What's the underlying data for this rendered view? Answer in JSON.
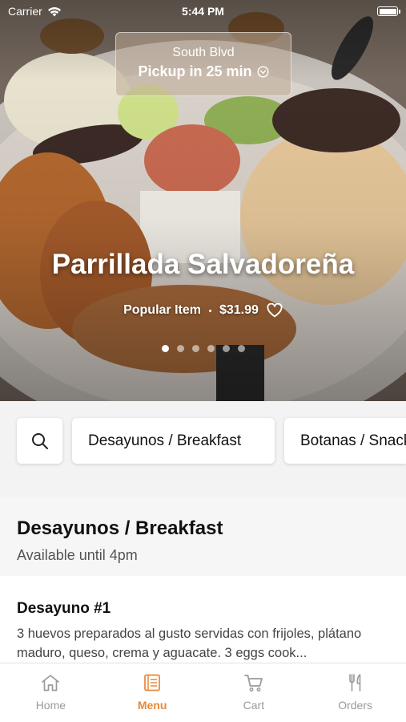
{
  "status_bar": {
    "carrier": "Carrier",
    "time": "5:44 PM"
  },
  "hero": {
    "location": "South Blvd",
    "pickup": "Pickup in 25 min",
    "title": "Parrillada Salvadoreña",
    "badge": "Popular Item",
    "price": "$31.99",
    "carousel": {
      "count": 6,
      "active_index": 0
    }
  },
  "categories": [
    "Desayunos / Breakfast",
    "Botanas / Snacks"
  ],
  "section": {
    "title": "Desayunos / Breakfast",
    "subtitle": "Available until 4pm"
  },
  "item": {
    "name": "Desayuno #1",
    "description": "3 huevos preparados al gusto servidas con frijoles, plátano maduro, queso, crema y aguacate. 3 eggs cook..."
  },
  "tabs": [
    {
      "label": "Home",
      "icon": "home-icon"
    },
    {
      "label": "Menu",
      "icon": "menu-book-icon"
    },
    {
      "label": "Cart",
      "icon": "cart-icon"
    },
    {
      "label": "Orders",
      "icon": "fork-knife-icon"
    }
  ],
  "colors": {
    "accent": "#e8873a",
    "inactive_tab": "#9a9a9a"
  }
}
